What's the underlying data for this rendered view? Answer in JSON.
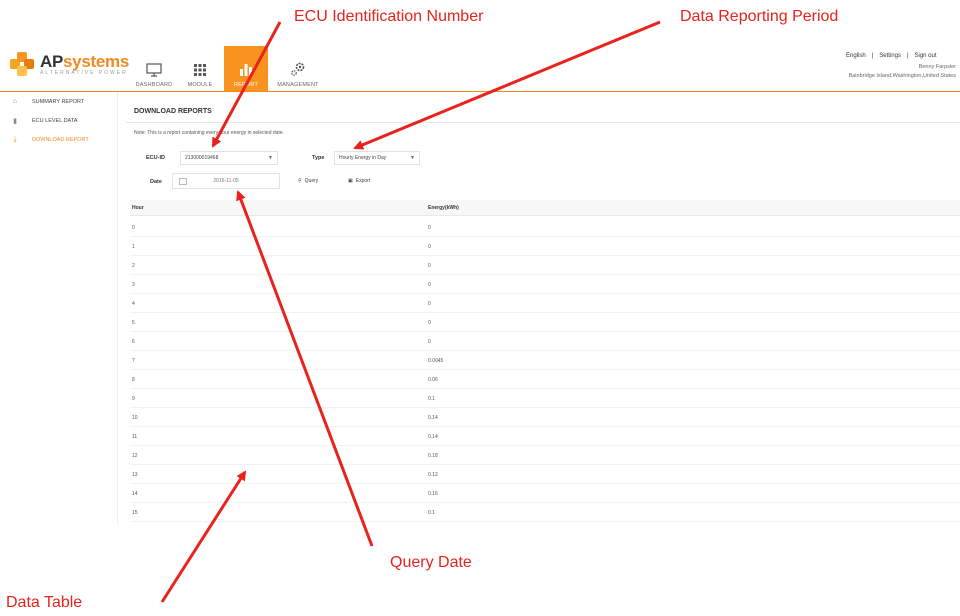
{
  "brand": {
    "name_ap": "AP",
    "name_sys": "systems",
    "tagline": "ALTERNATIVE POWER"
  },
  "nav": [
    {
      "label": "DASHBOARD",
      "icon": "monitor-icon"
    },
    {
      "label": "MODULE",
      "icon": "grid-icon"
    },
    {
      "label": "REPORT",
      "icon": "bar-chart-icon"
    },
    {
      "label": "MANAGEMENT",
      "icon": "gears-icon"
    }
  ],
  "top_links": {
    "language": "English",
    "sep1": "|",
    "settings": "Settings",
    "sep2": "|",
    "signout": "Sign out"
  },
  "user": {
    "name": "Benny Farpsler",
    "location": "Bainbridge Island,Washington,United States"
  },
  "sidebar": [
    {
      "label": "SUMMARY REPORT",
      "icon": "home-icon"
    },
    {
      "label": "ECU LEVEL DATA",
      "icon": "bar-chart-icon"
    },
    {
      "label": "DOWNLOAD REPORT",
      "icon": "download-icon"
    }
  ],
  "page": {
    "title": "DOWNLOAD REPORTS",
    "note": "Note: This is a report containing every hour energy in selected date."
  },
  "form": {
    "ecu_label": "ECU-ID",
    "ecu_value": "213000019468",
    "type_label": "Type",
    "type_value": "Hourly Energy in Day",
    "date_label": "Date",
    "date_value": "2016-11-05",
    "query_label": "Query",
    "export_label": "Export"
  },
  "table": {
    "headers": [
      "Hour",
      "Energy(kWh)"
    ],
    "rows": [
      [
        "0",
        "0"
      ],
      [
        "1",
        "0"
      ],
      [
        "2",
        "0"
      ],
      [
        "3",
        "0"
      ],
      [
        "4",
        "0"
      ],
      [
        "5",
        "0"
      ],
      [
        "6",
        "0"
      ],
      [
        "7",
        "0.0045"
      ],
      [
        "8",
        "0.06"
      ],
      [
        "9",
        "0.1"
      ],
      [
        "10",
        "0.14"
      ],
      [
        "11",
        "0.14"
      ],
      [
        "12",
        "0.18"
      ],
      [
        "13",
        "0.12"
      ],
      [
        "14",
        "0.16"
      ],
      [
        "15",
        "0.1"
      ]
    ]
  },
  "annotations": {
    "ecu": "ECU Identification Number",
    "period": "Data Reporting Period",
    "query_date": "Query Date",
    "table": "Data Table"
  },
  "colors": {
    "accent": "#f08a24",
    "nav_active": "#f7931e",
    "annotation": "#e8221c"
  }
}
